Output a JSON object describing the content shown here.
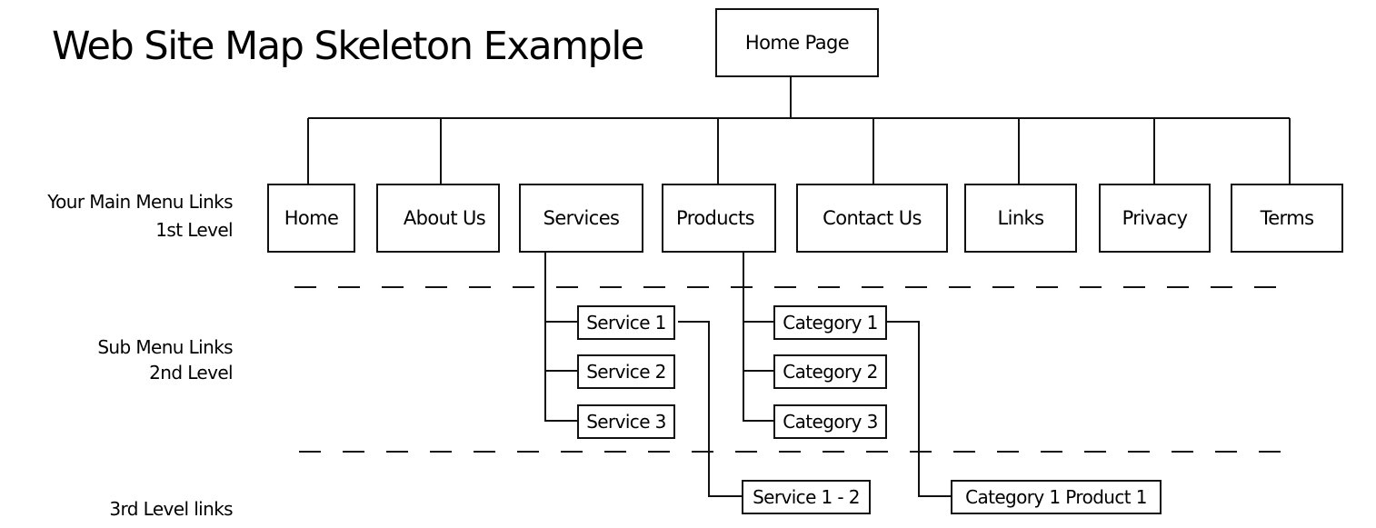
{
  "title": "Web Site Map Skeleton Example",
  "levels": {
    "first": {
      "line1": "Your Main Menu Links",
      "line2": "1st Level"
    },
    "second": {
      "line1": "Sub Menu Links",
      "line2": "2nd Level"
    },
    "third": {
      "line1": "3rd Level links"
    }
  },
  "root": {
    "label": "Home Page"
  },
  "main_menu": [
    {
      "label": "Home"
    },
    {
      "label": "About Us"
    },
    {
      "label": "Services"
    },
    {
      "label": "Products"
    },
    {
      "label": "Contact Us"
    },
    {
      "label": "Links"
    },
    {
      "label": "Privacy"
    },
    {
      "label": "Terms"
    }
  ],
  "services_sub": [
    {
      "label": "Service 1"
    },
    {
      "label": "Service 2"
    },
    {
      "label": "Service 3"
    }
  ],
  "products_sub": [
    {
      "label": "Category 1"
    },
    {
      "label": "Category 2"
    },
    {
      "label": "Category 3"
    }
  ],
  "third_level": {
    "service": {
      "label": "Service 1 - 2"
    },
    "category": {
      "label": "Category 1 Product 1"
    }
  }
}
